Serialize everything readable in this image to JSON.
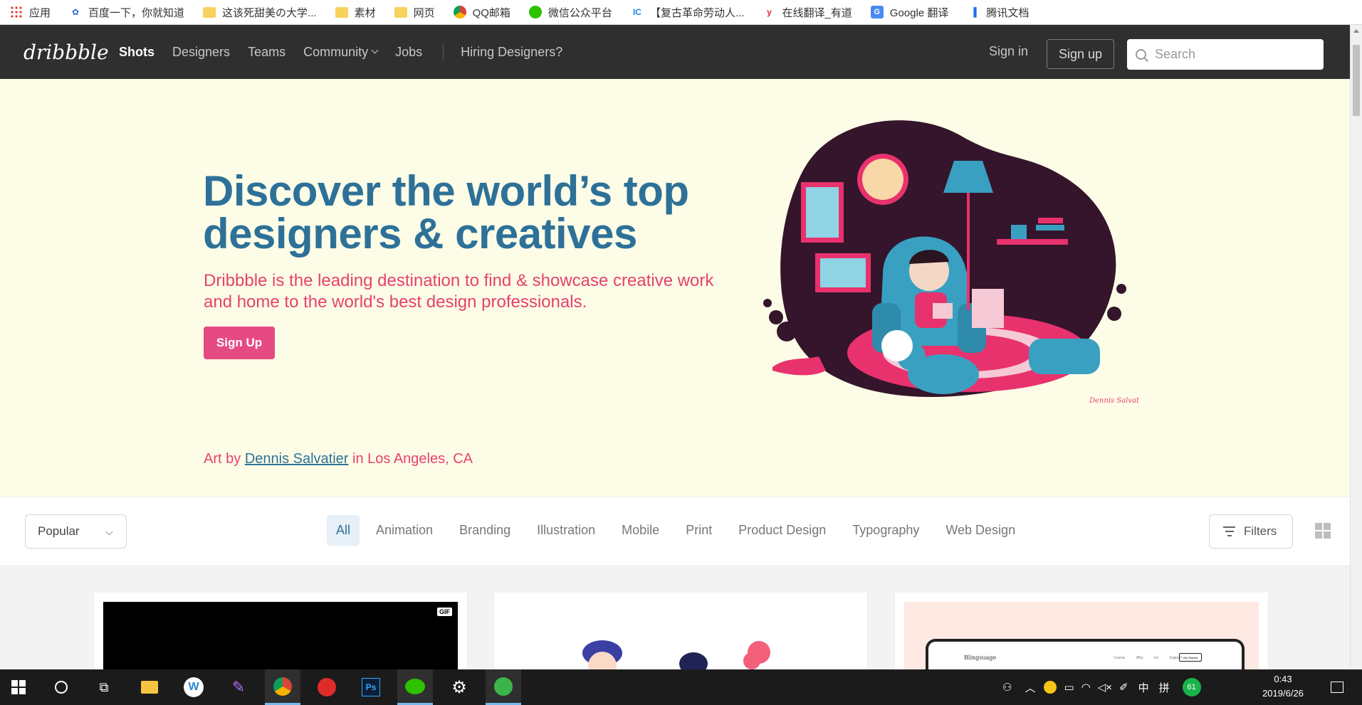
{
  "bookmarks": [
    {
      "label": "应用",
      "icon": "apps-grid-icon"
    },
    {
      "label": "百度一下，你就知道",
      "icon": "baidu-paw-icon"
    },
    {
      "label": "这该死甜美の大学...",
      "icon": "folder-icon"
    },
    {
      "label": "素材",
      "icon": "folder-icon"
    },
    {
      "label": "网页",
      "icon": "folder-icon"
    },
    {
      "label": "QQ邮箱",
      "icon": "chrome-icon"
    },
    {
      "label": "微信公众平台",
      "icon": "wechat-icon"
    },
    {
      "label": "【复古革命劳动人...",
      "icon": "ic-icon"
    },
    {
      "label": "在线翻译_有道",
      "icon": "youdao-icon"
    },
    {
      "label": "Google 翻译",
      "icon": "google-translate-icon"
    },
    {
      "label": "腾讯文档",
      "icon": "tencent-docs-icon"
    }
  ],
  "nav": {
    "logo": "dribbble",
    "links": [
      "Shots",
      "Designers",
      "Teams",
      "Community",
      "Jobs"
    ],
    "hiring": "Hiring Designers?",
    "signin": "Sign in",
    "signup": "Sign up",
    "search_placeholder": "Search"
  },
  "hero": {
    "title": "Discover the world’s top designers & creatives",
    "subtitle": "Dribbble is the leading destination to find & showcase creative work and home to the world's best design professionals.",
    "cta": "Sign Up",
    "credit_prefix": "Art by",
    "credit_artist": "Dennis Salvatier",
    "credit_suffix": "in Los Angeles, CA",
    "signature": "Dennis Salvatier"
  },
  "filters": {
    "sort": "Popular",
    "categories": [
      "All",
      "Animation",
      "Branding",
      "Illustration",
      "Mobile",
      "Print",
      "Product Design",
      "Typography",
      "Web Design"
    ],
    "active": "All",
    "filters_label": "Filters"
  },
  "shots": {
    "gif_badge": "GIF",
    "mock_brand": "Blingsuage",
    "mock_links": "Course Why Us Support",
    "mock_button": "Get Started"
  },
  "taskbar": {
    "time": "0:43",
    "date": "2019/6/26",
    "ime_lang": "中",
    "ime_mode": "拼",
    "badge": "61"
  },
  "colors": {
    "nav_bg": "#2f2f2f",
    "hero_bg": "#fdfde7",
    "title": "#2e7198",
    "pink": "#e6416e",
    "button": "#e54a83"
  }
}
